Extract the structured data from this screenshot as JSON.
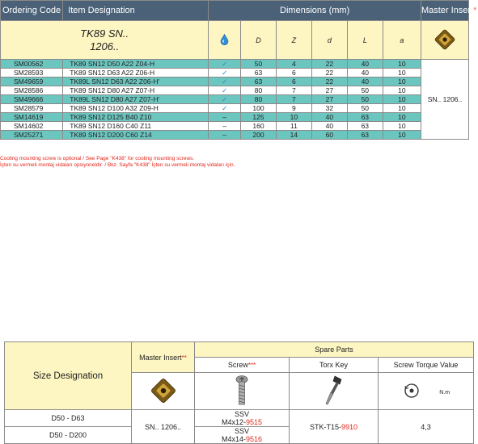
{
  "header": {
    "ordering_code": "Ordering Code",
    "item_designation": "Item Designation",
    "dimensions": "Dimensions (mm)",
    "master_insert": "Master Insert",
    "master_insert_mark": "*"
  },
  "subheader": {
    "family_line1": "TK89 SN..",
    "family_line2": "1206..",
    "col_D": "D",
    "col_Z": "Z",
    "col_d": "d",
    "col_L": "L",
    "col_a": "a"
  },
  "rows": [
    {
      "code": "SM00562",
      "designation": "TK89 SN12 D50 A22 Z04-H",
      "cool": "✓",
      "D": "50",
      "Z": "4",
      "d": "22",
      "L": "40",
      "a": "10"
    },
    {
      "code": "SM28593",
      "designation": "TK89 SN12 D63 A22 Z06-H",
      "cool": "✓",
      "D": "63",
      "Z": "6",
      "d": "22",
      "L": "40",
      "a": "10"
    },
    {
      "code": "SM49659",
      "designation": "TK89L SN12 D63 A22 Z06-H'",
      "cool": "✓",
      "D": "63",
      "Z": "6",
      "d": "22",
      "L": "40",
      "a": "10"
    },
    {
      "code": "SM28586",
      "designation": "TK89 SN12 D80 A27 Z07-H",
      "cool": "✓",
      "D": "80",
      "Z": "7",
      "d": "27",
      "L": "50",
      "a": "10"
    },
    {
      "code": "SM49666",
      "designation": "TK89L SN12 D80 A27 Z07-H'",
      "cool": "✓",
      "D": "80",
      "Z": "7",
      "d": "27",
      "L": "50",
      "a": "10"
    },
    {
      "code": "SM28579",
      "designation": "TK89 SN12 D100 A32 Z09-H",
      "cool": "✓",
      "D": "100",
      "Z": "9",
      "d": "32",
      "L": "50",
      "a": "10"
    },
    {
      "code": "SM14619",
      "designation": "TK89 SN12 D125 B40 Z10",
      "cool": "–",
      "D": "125",
      "Z": "10",
      "d": "40",
      "L": "63",
      "a": "10"
    },
    {
      "code": "SM14602",
      "designation": "TK89 SN12 D160 C40 Z11",
      "cool": "–",
      "D": "160",
      "Z": "11",
      "d": "40",
      "L": "63",
      "a": "10"
    },
    {
      "code": "SM25271",
      "designation": "TK89 SN12 D200 C60 Z14",
      "cool": "–",
      "D": "200",
      "Z": "14",
      "d": "60",
      "L": "63",
      "a": "10"
    }
  ],
  "master_insert_value": "SN.. 1206..",
  "notes": {
    "en": "Cooling mounting screw is optional / See Page \"K438\" for cooling mounting screws.",
    "tr": "İçten su vermeli montaj vidaları opsiyoneldir. / Bkz. Sayfa \"K438\" İçten su vermeli montaj vidaları için."
  },
  "spare": {
    "size_designation": "Size Designation",
    "master_insert": "Master Insert",
    "master_insert_mark": "**",
    "spare_parts": "Spare Parts",
    "screw": "Screw",
    "screw_mark": "***",
    "torx_key": "Torx Key",
    "screw_torque": "Screw Torque Value",
    "torque_unit": "N.m",
    "size1": "D50 - D63",
    "size2": "D50 - D200",
    "insert_value": "SN.. 1206..",
    "screw1_type": "SSV",
    "screw1_size": "M4x12-",
    "screw1_code": "9515",
    "screw2_type": "SSV",
    "screw2_size": "M4x14-",
    "screw2_code": "9516",
    "key_name": "STK-T15-",
    "key_code": "9910",
    "torque_value": "4,3"
  },
  "colors": {
    "header_bg": "#4a6178",
    "teal_row": "#6cc6c0",
    "cream": "#fdf6c2",
    "note_red": "#e0251b",
    "coolant_blue": "#3a7fc0"
  },
  "icons": [
    "coolant-drop-icon",
    "check-icon",
    "square-insert-icon",
    "screw-icon",
    "torx-key-icon",
    "torque-dial-icon"
  ]
}
